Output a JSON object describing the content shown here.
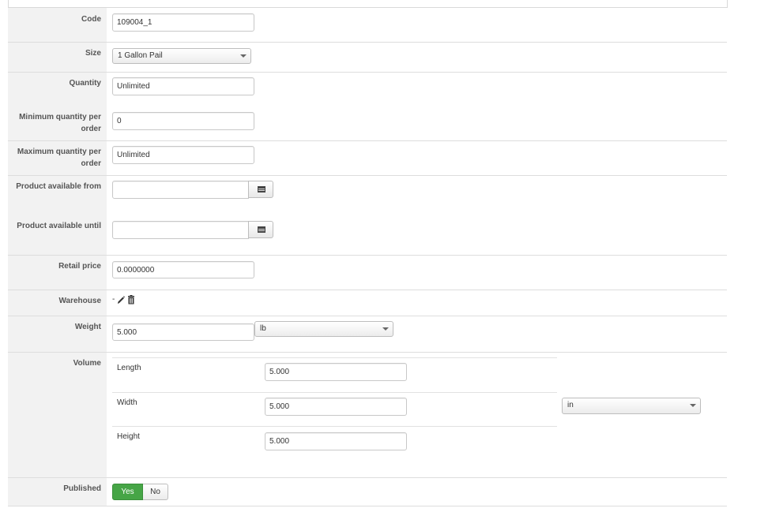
{
  "form": {
    "code": {
      "label": "Code",
      "value": "109004_1"
    },
    "size": {
      "label": "Size",
      "selected": "1 Gallon Pail"
    },
    "quantity": {
      "label": "Quantity",
      "value": "Unlimited"
    },
    "min_qty": {
      "label_line1": "Minimum quantity per",
      "label_line2": "order",
      "value": "0"
    },
    "max_qty": {
      "label_line1": "Maximum quantity per",
      "label_line2": "order",
      "value": "Unlimited"
    },
    "available_from": {
      "label": "Product available from",
      "value": ""
    },
    "available_until": {
      "label": "Product available until",
      "value": ""
    },
    "retail_price": {
      "label": "Retail price",
      "value": "0.0000000"
    },
    "warehouse": {
      "label": "Warehouse",
      "value": "-",
      "icons": [
        "pencil-icon",
        "trash-icon"
      ]
    },
    "weight": {
      "label": "Weight",
      "value": "5.000",
      "unit": "lb"
    },
    "volume": {
      "label": "Volume",
      "length": {
        "label": "Length",
        "value": "5.000"
      },
      "width": {
        "label": "Width",
        "value": "5.000"
      },
      "height": {
        "label": "Height",
        "value": "5.000"
      },
      "unit": "in"
    },
    "published": {
      "label": "Published",
      "yes": "Yes",
      "no": "No",
      "selected": "Yes"
    }
  },
  "colors": {
    "published_yes": "#46a546",
    "label_column": "#f2f2f2"
  }
}
